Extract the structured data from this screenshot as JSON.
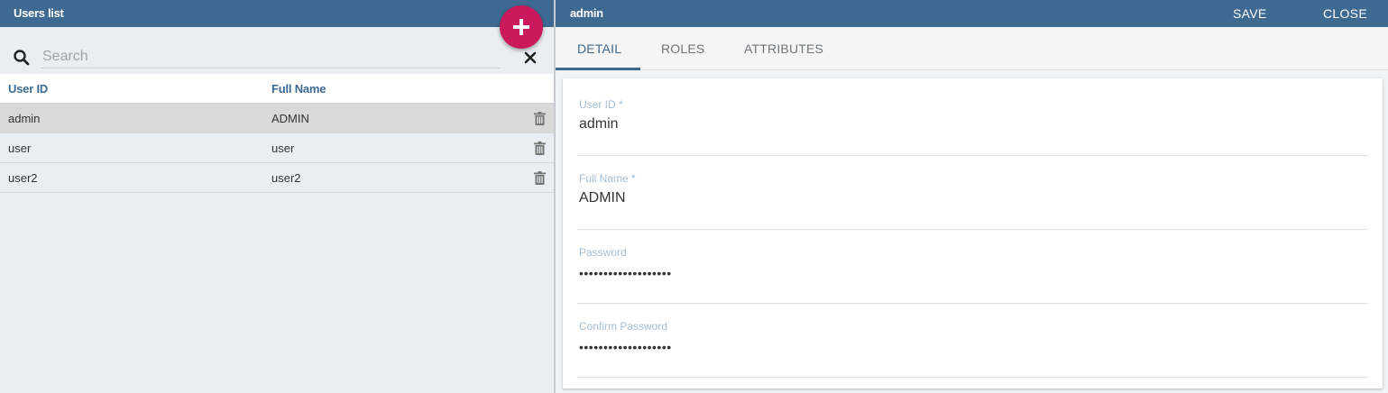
{
  "left_panel": {
    "title": "Users list",
    "add_icon": "plus-icon",
    "search": {
      "placeholder": "Search",
      "value": "",
      "icon": "search-icon",
      "clear_icon": "close-icon"
    },
    "columns": [
      "User ID",
      "Full Name"
    ],
    "rows": [
      {
        "user_id": "admin",
        "full_name": "ADMIN",
        "selected": true
      },
      {
        "user_id": "user",
        "full_name": "user",
        "selected": false
      },
      {
        "user_id": "user2",
        "full_name": "user2",
        "selected": false
      }
    ]
  },
  "right_panel": {
    "title": "admin",
    "save_label": "SAVE",
    "close_label": "CLOSE",
    "tabs": [
      {
        "label": "DETAIL",
        "active": true
      },
      {
        "label": "ROLES",
        "active": false
      },
      {
        "label": "ATTRIBUTES",
        "active": false
      }
    ],
    "fields": [
      {
        "label": "User ID *",
        "value": "admin"
      },
      {
        "label": "Full Name *",
        "value": "ADMIN"
      },
      {
        "label": "Password",
        "value": "•••••••••••••••••••"
      },
      {
        "label": "Confirm Password",
        "value": "•••••••••••••••••••"
      }
    ]
  },
  "colors": {
    "header": "#3e6990",
    "accent": "#3e6990",
    "fab": "#c9185b",
    "selected_row": "#d9d9d9",
    "field_label": "#a3bed3"
  }
}
